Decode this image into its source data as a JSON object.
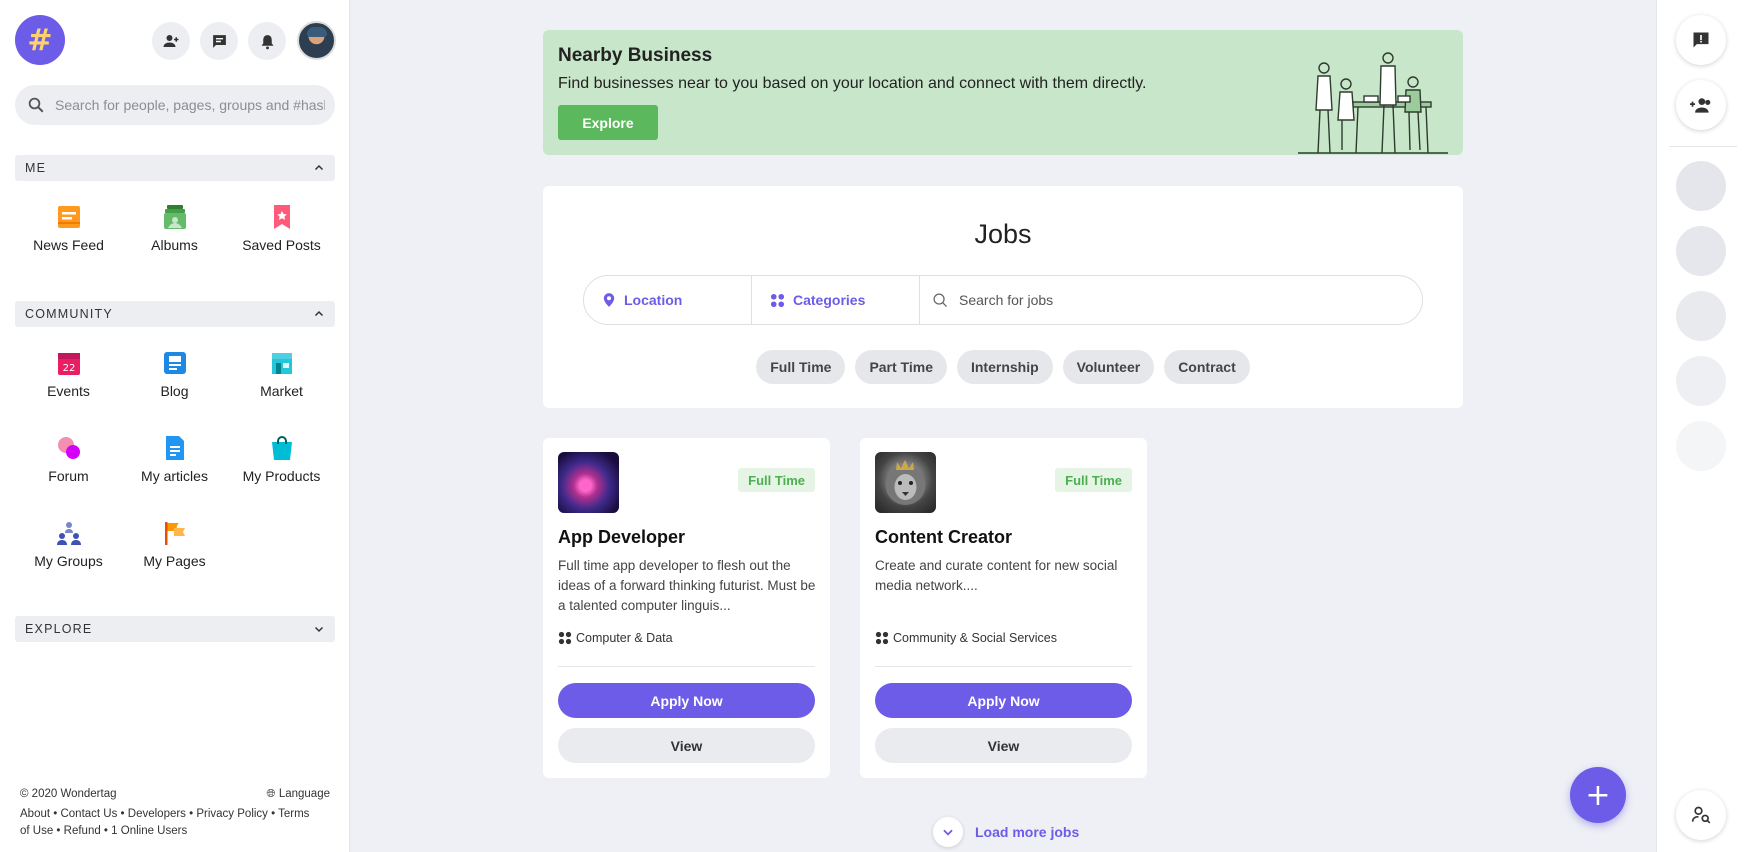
{
  "sidebar": {
    "search_placeholder": "Search for people, pages, groups and #hashtags",
    "sections": {
      "me": "ME",
      "community": "COMMUNITY",
      "explore": "EXPLORE"
    },
    "me_items": [
      "News Feed",
      "Albums",
      "Saved Posts"
    ],
    "community_items": [
      "Events",
      "Blog",
      "Market",
      "Forum",
      "My articles",
      "My Products",
      "My Groups",
      "My Pages"
    ],
    "events_date": "22",
    "footer": {
      "copyright": "© 2020 Wondertag",
      "language": "Language",
      "links_line1": "About • Contact Us • Developers • Privacy Policy • Terms",
      "links_line2": "of Use • Refund • 1 Online Users"
    }
  },
  "banner": {
    "title": "Nearby Business",
    "text": "Find businesses near to you based on your location and connect with them directly.",
    "button": "Explore"
  },
  "jobs": {
    "title": "Jobs",
    "location_label": "Location",
    "categories_label": "Categories",
    "search_placeholder": "Search for jobs",
    "chips": [
      "Full Time",
      "Part Time",
      "Internship",
      "Volunteer",
      "Contract"
    ],
    "listings": [
      {
        "title": "App Developer",
        "badge": "Full Time",
        "description": "Full time app developer to flesh out the ideas of a forward thinking futurist. Must be a talented computer linguis...",
        "category": "Computer & Data",
        "apply": "Apply Now",
        "view": "View"
      },
      {
        "title": "Content Creator",
        "badge": "Full Time",
        "description": "Create and curate content for new social media network....",
        "category": "Community & Social Services",
        "apply": "Apply Now",
        "view": "View"
      }
    ],
    "load_more": "Load more jobs"
  },
  "colors": {
    "accent": "#6c5ce7",
    "banner_bg": "#c8e6c9",
    "banner_button": "#5cb85c",
    "badge_text": "#4caf50"
  },
  "icons": {
    "logo": "hashtag-logo",
    "fab": "plus-icon"
  }
}
